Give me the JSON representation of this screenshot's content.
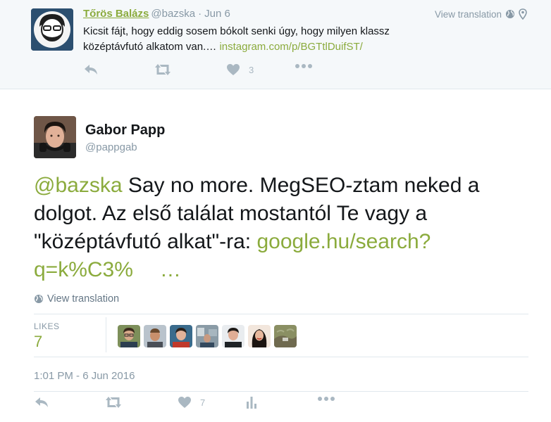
{
  "reply_tweet": {
    "name": "Tőrös Balázs",
    "handle": "@bazska",
    "separator": "·",
    "date": "Jun 6",
    "view_translation": "View translation",
    "text": "Kicsit fájt, hogy eddig sosem bókolt senki úgy, hogy milyen klassz középtávfutó alkatom van.… ",
    "link": "instagram.com/p/BGTtlDuifST/",
    "like_count": "3",
    "icons": [
      "reply-icon",
      "retweet-icon",
      "heart-icon",
      "more-icon",
      "globe-icon",
      "location-pin-icon"
    ]
  },
  "main_tweet": {
    "name": "Gabor Papp",
    "handle": "@pappgab",
    "mention": "@bazska",
    "text": " Say no more. MegSEO-ztam neked a dolgot. Az első találat mostantól Te vagy a \"középtávfutó alkat\"-ra: ",
    "link": "google.hu/search?q=k%C3%",
    "ellipsis": "…",
    "view_translation": "View translation",
    "stats": {
      "likes_label": "LIKES",
      "likes_count": "7"
    },
    "timestamp": "1:01 PM - 6 Jun 2016",
    "actions": {
      "like_count": "7"
    },
    "icons": [
      "reply-icon",
      "retweet-icon",
      "heart-icon",
      "analytics-icon",
      "more-icon",
      "globe-icon"
    ]
  },
  "colors": {
    "accent": "#8bab3d",
    "muted_text": "#8899a6",
    "icon": "#aab8c2",
    "reply_background": "#f5f8fa",
    "divider": "#e1e8ed"
  }
}
